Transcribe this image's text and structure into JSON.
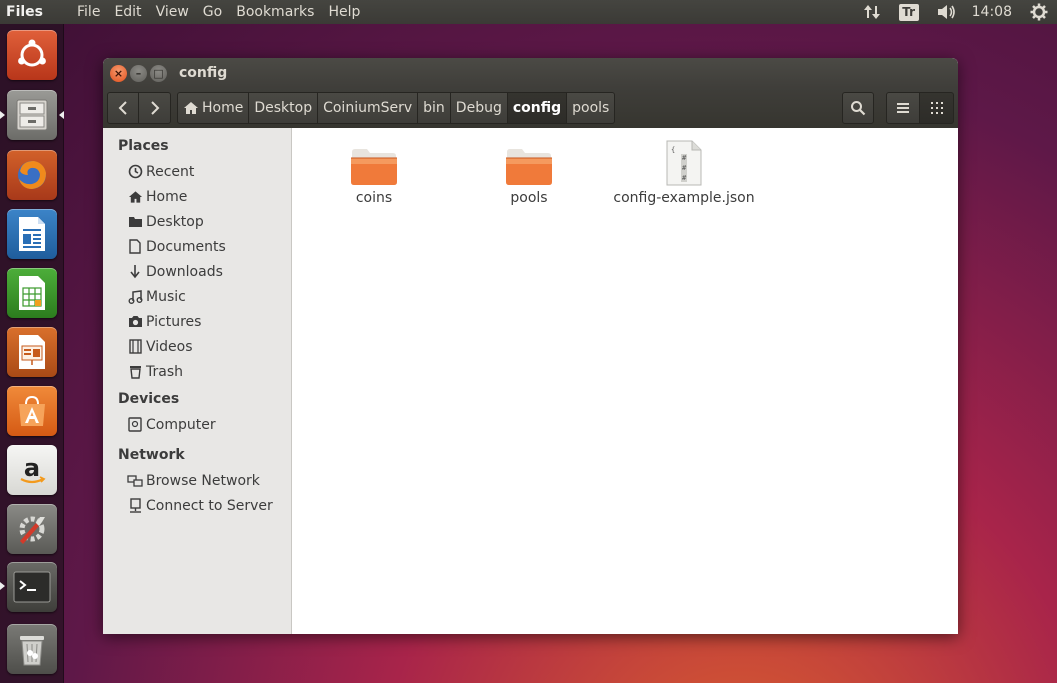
{
  "top_panel": {
    "app_name": "Files",
    "menu": [
      "File",
      "Edit",
      "View",
      "Go",
      "Bookmarks",
      "Help"
    ],
    "keyboard_indicator": "Tr",
    "clock": "14:08"
  },
  "launcher": {
    "items": [
      "dash-home",
      "files",
      "firefox",
      "libreoffice-writer",
      "libreoffice-calc",
      "libreoffice-impress",
      "ubuntu-software-center",
      "amazon",
      "system-settings",
      "terminal",
      "trash"
    ],
    "colors": {
      "ubuntu": "#dd4814",
      "firefox": "#e66000",
      "writer": "#2a6fb6",
      "calc": "#3b9a2c",
      "impress": "#c65a1b",
      "software": "#f07a24",
      "amazon": "#f3f3f3"
    }
  },
  "window": {
    "title": "config",
    "breadcrumbs": [
      "Home",
      "Desktop",
      "CoiniumServ",
      "bin",
      "Debug",
      "config",
      "pools"
    ],
    "active_breadcrumb": "config"
  },
  "sidebar": {
    "places_title": "Places",
    "places": [
      "Recent",
      "Home",
      "Desktop",
      "Documents",
      "Downloads",
      "Music",
      "Pictures",
      "Videos",
      "Trash"
    ],
    "devices_title": "Devices",
    "devices": [
      "Computer"
    ],
    "network_title": "Network",
    "network": [
      "Browse Network",
      "Connect to Server"
    ]
  },
  "files": [
    {
      "name": "coins",
      "type": "folder"
    },
    {
      "name": "pools",
      "type": "folder"
    },
    {
      "name": "config-example.json",
      "type": "text-file"
    }
  ],
  "colors": {
    "folder": "#f07a3a",
    "accent": "#e24f1c",
    "panel": "#3c3b37"
  }
}
